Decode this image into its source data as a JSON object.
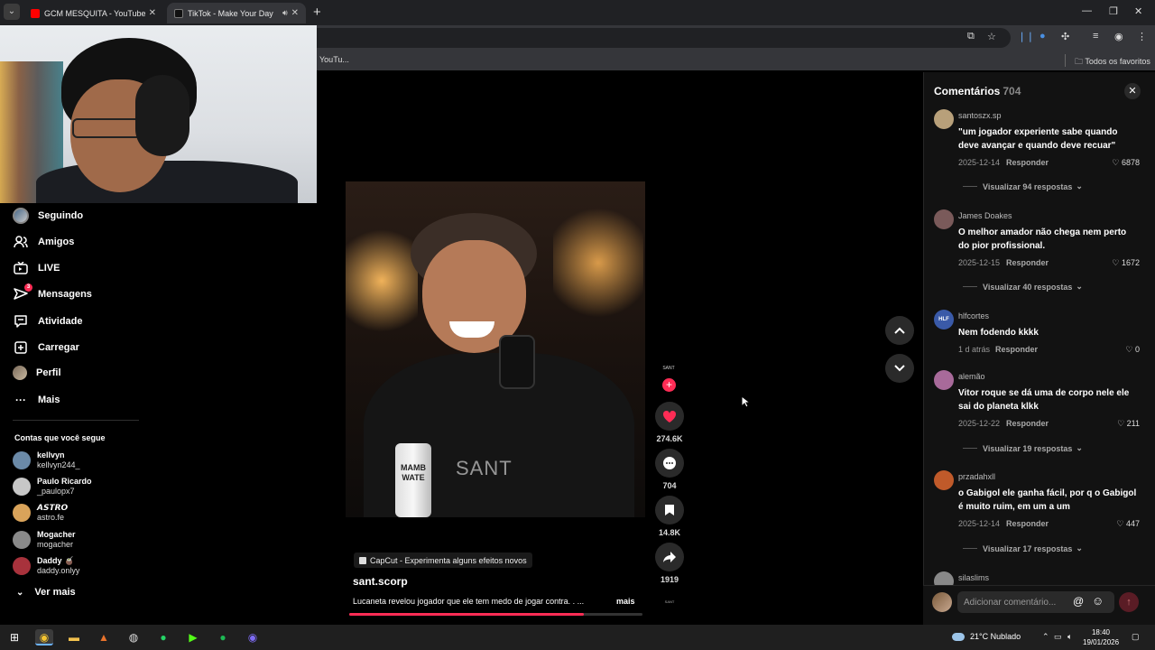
{
  "browser": {
    "tabs": [
      {
        "title": "GCM MESQUITA - YouTube",
        "active": false
      },
      {
        "title": "TikTok - Make Your Day",
        "active": true
      }
    ],
    "bookmarks": {
      "partial": "YouTu...",
      "all_favorites": "Todos os favoritos"
    }
  },
  "nav": {
    "items": [
      {
        "label": "Seguindo",
        "icon": "avatar-icon"
      },
      {
        "label": "Amigos",
        "icon": "friends-icon"
      },
      {
        "label": "LIVE",
        "icon": "live-icon"
      },
      {
        "label": "Mensagens",
        "icon": "messages-icon",
        "badge": "3"
      },
      {
        "label": "Atividade",
        "icon": "activity-icon"
      },
      {
        "label": "Carregar",
        "icon": "upload-icon"
      },
      {
        "label": "Perfil",
        "icon": "profile-icon"
      },
      {
        "label": "Mais",
        "icon": "more-icon"
      }
    ],
    "following_title": "Contas que você segue",
    "accounts": [
      {
        "name": "kellvyn",
        "handle": "kellvyn244_",
        "color": "#6b8aa8"
      },
      {
        "name": "Paulo Ricardo",
        "handle": "_paulopx7",
        "color": "#c7c7c7"
      },
      {
        "name": "𝘼𝙎𝙏𝙍𝙊",
        "handle": "astro.fe",
        "color": "#d9a35a"
      },
      {
        "name": "Mogacher",
        "handle": "mogacher",
        "color": "#8a8a8a"
      },
      {
        "name": "Daddy 🧉",
        "handle": "daddy.onlyy",
        "color": "#a8323c"
      }
    ],
    "see_more": "Ver mais"
  },
  "video": {
    "watermark": "SANT",
    "can_text": "MAMB WATE",
    "capcut": "CapCut - Experimenta alguns efeitos novos",
    "author": "sant.scorp",
    "description": "Lucaneta revelou jogador que ele tem medo de jogar contra. . ...",
    "more": "mais",
    "progress": 0.8,
    "creator_label": "SANT",
    "actions": {
      "likes": "274.6K",
      "comments": "704",
      "saves": "14.8K",
      "shares": "1919"
    }
  },
  "comments_panel": {
    "title": "Comentários",
    "count": "704",
    "placeholder": "Adicionar comentário...",
    "reply_label": "Responder",
    "comments": [
      {
        "user": "santoszx.sp",
        "text": "\"um jogador experiente sabe quando deve avançar e quando deve recuar\"",
        "date": "2025-12-14",
        "likes": "6878",
        "replies": "Visualizar 94 respostas",
        "color": "#b8a07a"
      },
      {
        "user": "James Doakes",
        "text": "O melhor amador não chega nem perto do pior profissional.",
        "date": "2025-12-15",
        "likes": "1672",
        "replies": "Visualizar 40 respostas",
        "color": "#7a5a5a"
      },
      {
        "user": "hlfcortes",
        "text": "Nem fodendo kkkk",
        "date": "1 d atrás",
        "likes": "0",
        "replies": "",
        "color": "#3a5aa8"
      },
      {
        "user": "alemão",
        "text": "Vitor roque se dá uma de corpo nele ele sai do planeta klkk",
        "date": "2025-12-22",
        "likes": "211",
        "replies": "Visualizar 19 respostas",
        "color": "#a86a9a"
      },
      {
        "user": "przadahxll",
        "text": "o Gabigol ele ganha fácil, por q o Gabigol é muito ruim, em um a um",
        "date": "2025-12-14",
        "likes": "447",
        "replies": "Visualizar 17 respostas",
        "color": "#c05a2a"
      },
      {
        "user": "silaslims",
        "text": "",
        "date": "",
        "likes": "",
        "replies": "",
        "color": "#888888"
      }
    ]
  },
  "taskbar": {
    "weather": "21°C  Nublado",
    "time": "18:40",
    "date": "19/01/2026"
  }
}
